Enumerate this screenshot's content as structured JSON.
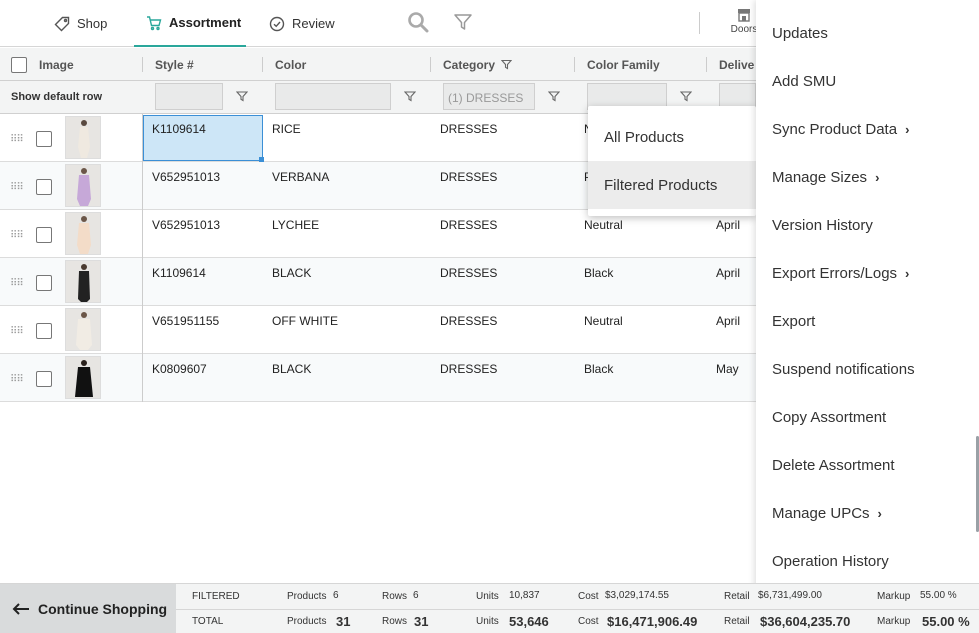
{
  "nav": {
    "tabs": [
      {
        "label": "Shop",
        "icon": "tag-icon"
      },
      {
        "label": "Assortment",
        "icon": "cart-icon"
      },
      {
        "label": "Review",
        "icon": "check-circle-icon"
      }
    ],
    "doors_label": "Doors",
    "accent_color": "#2aa79b"
  },
  "grid": {
    "columns": [
      "Image",
      "Style #",
      "Color",
      "Category",
      "Color Family",
      "Delive"
    ],
    "show_default_row": "Show default row",
    "category_filter_value": "(1) DRESSES",
    "rows": [
      {
        "style": "K1109614",
        "color": "RICE",
        "category": "DRESSES",
        "color_family": "N",
        "delivery": ""
      },
      {
        "style": "V652951013",
        "color": "VERBANA",
        "category": "DRESSES",
        "color_family": "P",
        "delivery": ""
      },
      {
        "style": "V652951013",
        "color": "LYCHEE",
        "category": "DRESSES",
        "color_family": "Neutral",
        "delivery": "April"
      },
      {
        "style": "K1109614",
        "color": "BLACK",
        "category": "DRESSES",
        "color_family": "Black",
        "delivery": "April"
      },
      {
        "style": "V651951155",
        "color": "OFF WHITE",
        "category": "DRESSES",
        "color_family": "Neutral",
        "delivery": "April"
      },
      {
        "style": "K0809607",
        "color": "BLACK",
        "category": "DRESSES",
        "color_family": "Black",
        "delivery": "May"
      }
    ]
  },
  "popover": {
    "items": [
      "All Products",
      "Filtered Products"
    ]
  },
  "menu": {
    "items": [
      {
        "label": "Updates",
        "submenu": false
      },
      {
        "label": "Add SMU",
        "submenu": false
      },
      {
        "label": "Sync Product Data",
        "submenu": true
      },
      {
        "label": "Manage Sizes",
        "submenu": true
      },
      {
        "label": "Version History",
        "submenu": false
      },
      {
        "label": "Export Errors/Logs",
        "submenu": true
      },
      {
        "label": "Export",
        "submenu": false
      },
      {
        "label": "Suspend notifications",
        "submenu": false
      },
      {
        "label": "Copy Assortment",
        "submenu": false
      },
      {
        "label": "Delete Assortment",
        "submenu": false
      },
      {
        "label": "Manage UPCs",
        "submenu": true
      },
      {
        "label": "Operation History",
        "submenu": false
      }
    ]
  },
  "footer": {
    "continue_label": "Continue Shopping",
    "labels": {
      "products": "Products",
      "rows": "Rows",
      "units": "Units",
      "cost": "Cost",
      "retail": "Retail",
      "markup": "Markup"
    },
    "filtered": {
      "label": "FILTERED",
      "products": "6",
      "rows": "6",
      "units": "10,837",
      "cost": "$3,029,174.55",
      "retail": "$6,731,499.00",
      "markup": "55.00 %"
    },
    "total": {
      "label": "TOTAL",
      "products": "31",
      "rows": "31",
      "units": "53,646",
      "cost": "$16,471,906.49",
      "retail": "$36,604,235.70",
      "markup": "55.00 %"
    }
  }
}
